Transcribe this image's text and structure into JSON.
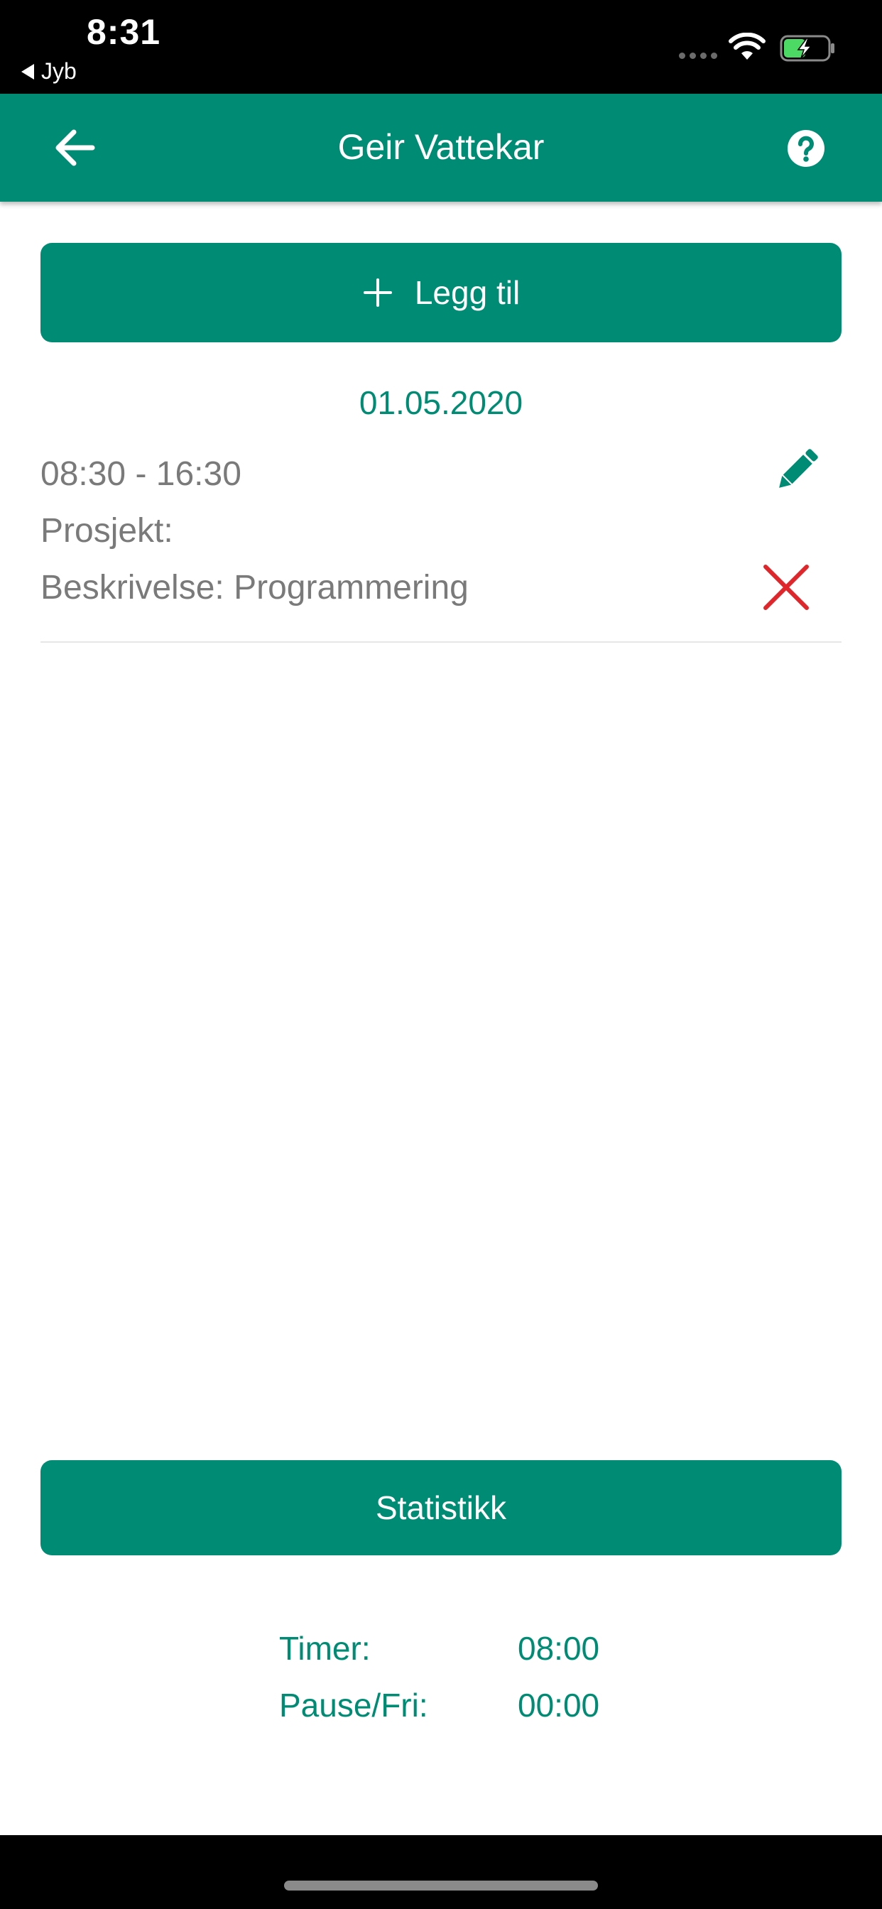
{
  "status_bar": {
    "time": "8:31",
    "back_app": "Jyb"
  },
  "header": {
    "title": "Geir Vattekar",
    "back_icon": "arrow-left-icon",
    "help_icon": "question-circle-icon",
    "background": "#008B74"
  },
  "actions": {
    "add_label": "Legg til",
    "add_icon": "plus-icon",
    "stats_label": "Statistikk"
  },
  "entries": [
    {
      "date": "01.05.2020",
      "time_range": "08:30 - 16:30",
      "project": "Prosjekt:",
      "description": "Beskrivelse: Programmering",
      "edit_icon": "pencil-icon",
      "delete_icon": "close-icon"
    }
  ],
  "summary": {
    "hours_label": "Timer:",
    "hours_value": "08:00",
    "pause_label": "Pause/Fri:",
    "pause_value": "00:00"
  },
  "colors": {
    "accent": "#008B74",
    "delete": "#E0262B",
    "text_muted": "#7a7a7a"
  }
}
